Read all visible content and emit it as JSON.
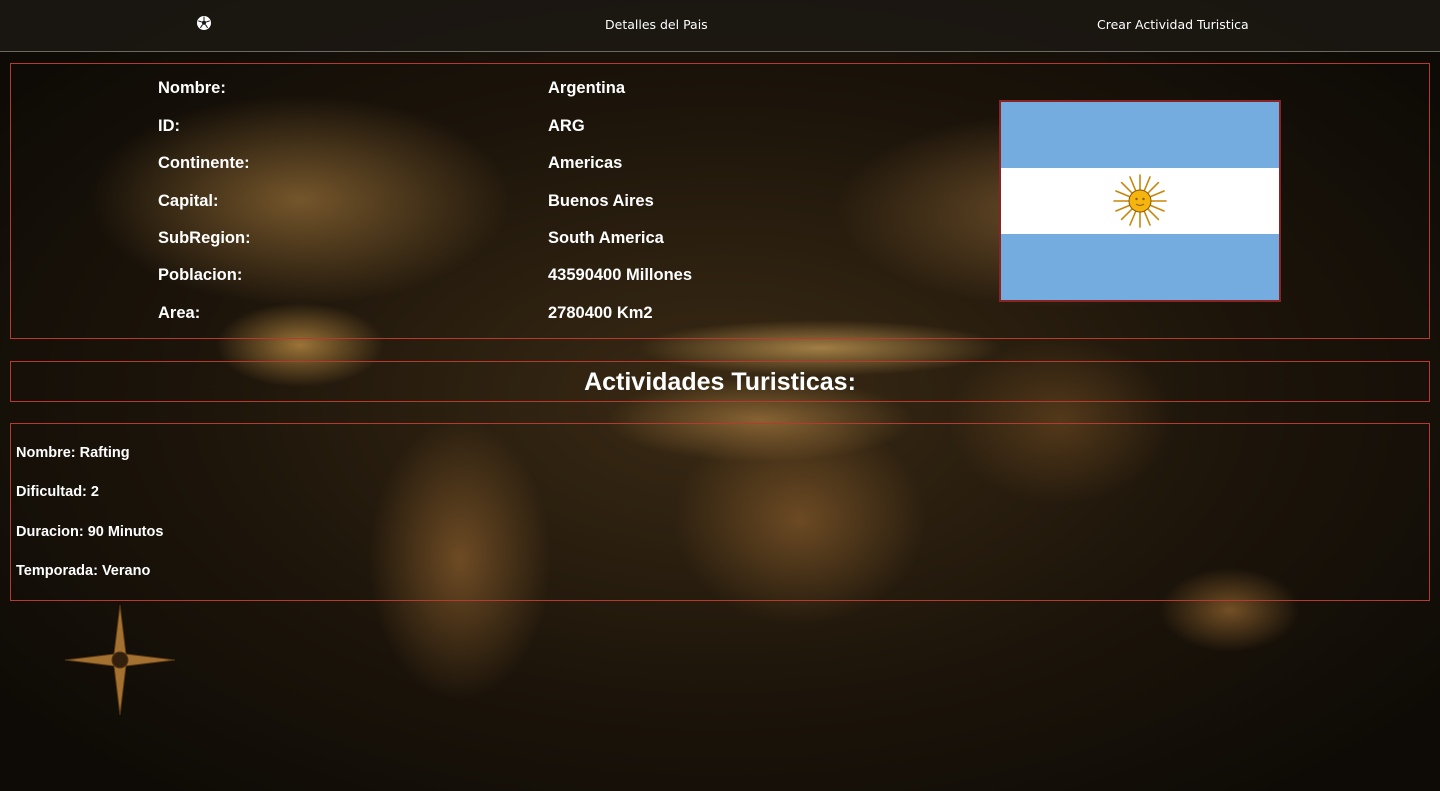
{
  "navbar": {
    "home_icon": "soccer-ball-icon",
    "details_label": "Detalles del Pais",
    "create_label": "Crear Actividad Turistica"
  },
  "country": {
    "labels": {
      "name": "Nombre:",
      "id": "ID:",
      "continent": "Continente:",
      "capital": "Capital:",
      "subregion": "SubRegion:",
      "population": "Poblacion:",
      "area": "Area:"
    },
    "values": {
      "name": "Argentina",
      "id": "ARG",
      "continent": "Americas",
      "capital": "Buenos Aires",
      "subregion": "South America",
      "population": "43590400 Millones",
      "area": "2780400 Km2"
    },
    "flag": {
      "icon": "argentina-flag",
      "stripe_color": "#74acdf",
      "sun_color": "#f6b40e"
    }
  },
  "activities_section": {
    "title": "Actividades Turisticas:"
  },
  "activities": [
    {
      "name": "Nombre: Rafting",
      "difficulty": "Dificultad: 2",
      "duration": "Duracion: 90 Minutos",
      "season": "Temporada: Verano"
    }
  ],
  "theme": {
    "border_color": "#b83a2e",
    "text_color": "#ffffff"
  }
}
